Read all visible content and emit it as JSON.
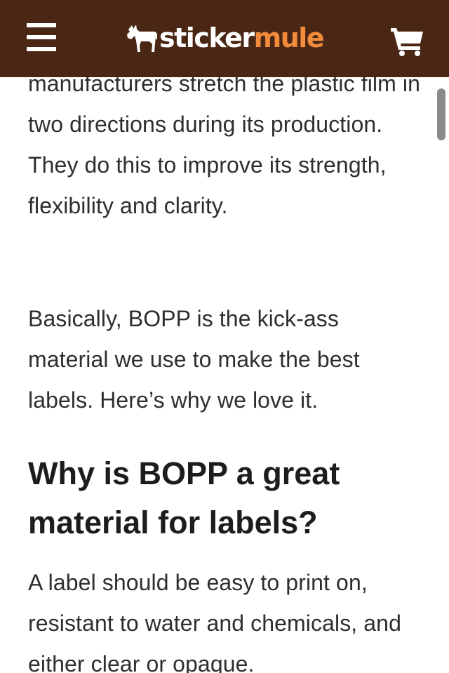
{
  "navbar": {
    "background": "#4a2715",
    "menu_icon": "hamburger-menu-icon",
    "logo": {
      "icon": "mule-icon",
      "word1": "sticker",
      "word2": "mule",
      "word1_color": "#ffffff",
      "word2_color": "#f38b3c"
    },
    "cart_icon": "shopping-cart-icon"
  },
  "article": {
    "paragraphs": [
      "manufacturers stretch the plastic film in two directions during its production. They do this to improve its strength, flexibility and clarity.",
      "Basically, BOPP is the kick-ass material we use to make the best labels. Here’s why we love it."
    ],
    "heading": "Why is BOPP a great material for labels?",
    "paragraph_after_heading": "A label should be easy to print on, resistant to water and chemicals, and either clear or opaque."
  }
}
